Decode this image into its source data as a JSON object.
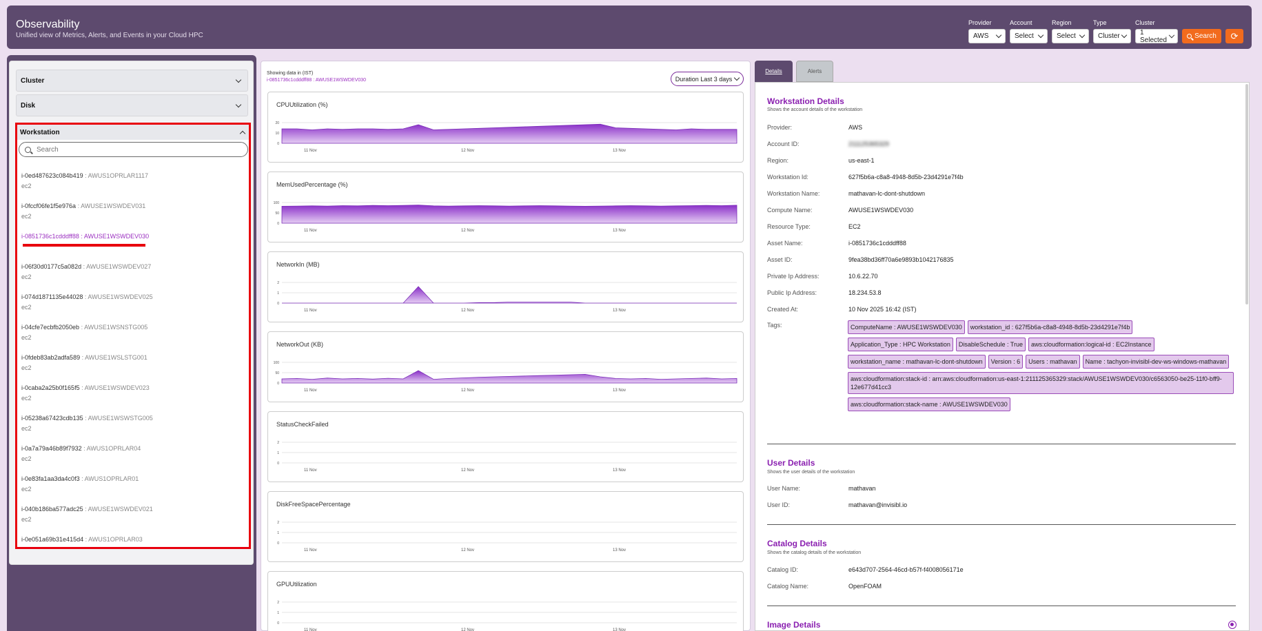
{
  "header": {
    "title": "Observability",
    "subtitle": "Unified view of Metrics, Alerts, and Events in your Cloud HPC",
    "filters": [
      {
        "label": "Provider",
        "value": "AWS"
      },
      {
        "label": "Account",
        "value": "Select"
      },
      {
        "label": "Region",
        "value": "Select"
      },
      {
        "label": "Type",
        "value": "Cluster"
      },
      {
        "label": "Cluster",
        "value": "1 Selected"
      }
    ],
    "search_label": "Search"
  },
  "sidebar": {
    "cluster_label": "Cluster",
    "disk_label": "Disk",
    "workstation_label": "Workstation",
    "search_placeholder": "Search",
    "items": [
      {
        "id": "i-0ed487623c084b419",
        "name": " : AWUS1OPRLAR1117",
        "type": "ec2"
      },
      {
        "id": "i-0fccf06fe1f5e976a",
        "name": " : AWUSE1WSWDEV031",
        "type": "ec2"
      },
      {
        "id": "i-0851736c1cdddff88",
        "name": " : AWUSE1WSWDEV030",
        "type": "",
        "active": true
      },
      {
        "id": "i-06f30d0177c5a082d",
        "name": " : AWUSE1WSWDEV027",
        "type": "ec2"
      },
      {
        "id": "i-074d1871135e44028",
        "name": " : AWUSE1WSWDEV025",
        "type": "ec2"
      },
      {
        "id": "i-04cfe7ecbfb2050eb",
        "name": " : AWUSE1WSNSTG005",
        "type": "ec2"
      },
      {
        "id": "i-0fdeb83ab2adfa589",
        "name": " : AWUSE1WSLSTG001",
        "type": "ec2"
      },
      {
        "id": "i-0caba2a25b0f165f5",
        "name": " : AWUSE1WSWDEV023",
        "type": "ec2"
      },
      {
        "id": "i-05238a67423cdb135",
        "name": " : AWUSE1WSWSTG005",
        "type": "ec2"
      },
      {
        "id": "i-0a7a79a46b89f7932",
        "name": " : AWUS1OPRLAR04",
        "type": "ec2"
      },
      {
        "id": "i-0e83fa1aa3da4c0f3",
        "name": " : AWUS1OPRLAR01",
        "type": "ec2"
      },
      {
        "id": "i-040b186ba577adc25",
        "name": " : AWUSE1WSWDEV021",
        "type": "ec2"
      },
      {
        "id": "i-0e051a69b31e415d4",
        "name": " : AWUS1OPRLAR03",
        "type": "ec2"
      }
    ]
  },
  "main": {
    "showing_label": "Showing data in (IST)",
    "instance_label": "i-0851736c1cdddff88 : AWUSE1WSWDEV030",
    "duration_label": "Duration  Last 3 days"
  },
  "chart_data": [
    {
      "type": "area",
      "title": "CPUUtilization  (%)",
      "x": [
        "11 Nov",
        "12 Nov",
        "13 Nov"
      ],
      "yticks": [
        "20",
        "10",
        "0"
      ],
      "ylim": [
        0,
        20
      ],
      "series": [
        {
          "values": [
            14,
            14,
            13,
            14,
            13.5,
            14,
            14,
            13.5,
            14,
            18,
            13,
            13.5,
            14,
            14.5,
            15,
            15.5,
            16,
            16.5,
            17,
            17.5,
            18,
            18.5,
            15,
            14.5,
            14,
            13.5,
            13,
            14,
            13.5,
            13.5,
            13.5
          ]
        }
      ]
    },
    {
      "type": "area",
      "title": "MemUsedPercentage  (%)",
      "x": [
        "11 Nov",
        "12 Nov",
        "13 Nov"
      ],
      "yticks": [
        "100",
        "50",
        "0"
      ],
      "ylim": [
        0,
        100
      ],
      "series": [
        {
          "values": [
            82,
            83,
            84,
            83,
            85,
            84,
            86,
            85,
            86,
            88,
            84,
            83,
            84,
            85,
            84,
            83,
            84,
            85,
            84,
            83,
            82,
            83,
            84,
            85,
            84,
            83,
            84,
            85,
            86,
            85,
            87
          ]
        }
      ]
    },
    {
      "type": "area",
      "title": "NetworkIn  (MB)",
      "x": [
        "11 Nov",
        "12 Nov",
        "13 Nov"
      ],
      "yticks": [
        "2",
        "1",
        "0"
      ],
      "ylim": [
        0,
        2
      ],
      "series": [
        {
          "values": [
            0,
            0,
            0,
            0,
            0,
            0,
            0,
            0,
            0,
            1.6,
            0,
            0,
            0,
            0.05,
            0.05,
            0.1,
            0.1,
            0.1,
            0.1,
            0.1,
            0,
            0,
            0,
            0,
            0,
            0,
            0,
            0,
            0,
            0,
            0
          ]
        }
      ]
    },
    {
      "type": "area",
      "title": "NetworkOut  (KB)",
      "x": [
        "11 Nov",
        "12 Nov",
        "13 Nov"
      ],
      "yticks": [
        "100",
        "50",
        "0"
      ],
      "ylim": [
        0,
        100
      ],
      "series": [
        {
          "values": [
            20,
            22,
            18,
            24,
            20,
            22,
            19,
            23,
            20,
            60,
            18,
            22,
            25,
            28,
            30,
            32,
            34,
            36,
            38,
            40,
            42,
            30,
            22,
            20,
            22,
            18,
            20,
            22,
            24,
            20,
            22
          ]
        }
      ]
    },
    {
      "type": "line",
      "title": "StatusCheckFailed",
      "x": [
        "11 Nov",
        "12 Nov",
        "13 Nov"
      ],
      "yticks": [
        "2",
        "1",
        "0"
      ],
      "ylim": [
        0,
        2
      ],
      "series": []
    },
    {
      "type": "line",
      "title": "DiskFreeSpacePercentage",
      "x": [
        "11 Nov",
        "12 Nov",
        "13 Nov"
      ],
      "yticks": [
        "2",
        "1",
        "0"
      ],
      "ylim": [
        0,
        2
      ],
      "series": []
    },
    {
      "type": "line",
      "title": "GPUUtilization",
      "x": [
        "11 Nov",
        "12 Nov",
        "13 Nov"
      ],
      "yticks": [
        "2",
        "1",
        "0"
      ],
      "ylim": [
        0,
        2
      ],
      "series": []
    }
  ],
  "details": {
    "tab_details": "Details",
    "tab_alerts": "Alerts",
    "workstation": {
      "title": "Workstation Details",
      "subtitle": "Shows the account details of the workstation",
      "rows": [
        {
          "label": "Provider:",
          "value": "AWS"
        },
        {
          "label": "Account ID:",
          "value": "211125365329"
        },
        {
          "label": "Region:",
          "value": "us-east-1"
        },
        {
          "label": "Workstation Id:",
          "value": "627f5b6a-c8a8-4948-8d5b-23d4291e7f4b"
        },
        {
          "label": "Workstation Name:",
          "value": "mathavan-lc-dont-shutdown"
        },
        {
          "label": "Compute Name:",
          "value": "AWUSE1WSWDEV030"
        },
        {
          "label": "Resource Type:",
          "value": "EC2"
        },
        {
          "label": "Asset Name:",
          "value": "i-0851736c1cdddff88"
        },
        {
          "label": "Asset ID:",
          "value": "9fea38bd36ff70a6e9893b1042176835"
        },
        {
          "label": "Private Ip Address:",
          "value": "10.6.22.70"
        },
        {
          "label": "Public Ip Address:",
          "value": "18.234.53.8"
        },
        {
          "label": "Created At:",
          "value": "10 Nov 2025 16:42  (IST)"
        }
      ],
      "tags_label": "Tags:",
      "tags": [
        "ComputeName : AWUSE1WSWDEV030",
        "workstation_id : 627f5b6a-c8a8-4948-8d5b-23d4291e7f4b",
        "Application_Type : HPC Workstation",
        "DisableSchedule : True",
        "aws:cloudformation:logical-id : EC2Instance",
        "workstation_name : mathavan-lc-dont-shutdown",
        "Version : 6",
        "Users : mathavan",
        "Name : tachyon-invisibl-dev-ws-windows-mathavan",
        "aws:cloudformation:stack-id : arn:aws:cloudformation:us-east-1:211125365329:stack/AWUSE1WSWDEV030/c6563050-be25-11f0-bff9-12e677d41cc3",
        "aws:cloudformation:stack-name : AWUSE1WSWDEV030"
      ]
    },
    "user": {
      "title": "User Details",
      "subtitle": "Shows the user details of the workstation",
      "rows": [
        {
          "label": "User Name:",
          "value": "mathavan"
        },
        {
          "label": "User ID:",
          "value": "mathavan@invisibl.io"
        }
      ]
    },
    "catalog": {
      "title": "Catalog Details",
      "subtitle": "Shows the catalog details of the workstation",
      "rows": [
        {
          "label": "Catalog ID:",
          "value": "e643d707-2564-46cd-b57f-f4008056171e"
        },
        {
          "label": "Catalog Name:",
          "value": "OpenFOAM"
        }
      ]
    },
    "image": {
      "title": "Image Details"
    }
  },
  "colors": {
    "accent": "#8a1fb0",
    "header": "#5d4a6e",
    "orange": "#f26b1d",
    "highlight": "#e8000d"
  }
}
